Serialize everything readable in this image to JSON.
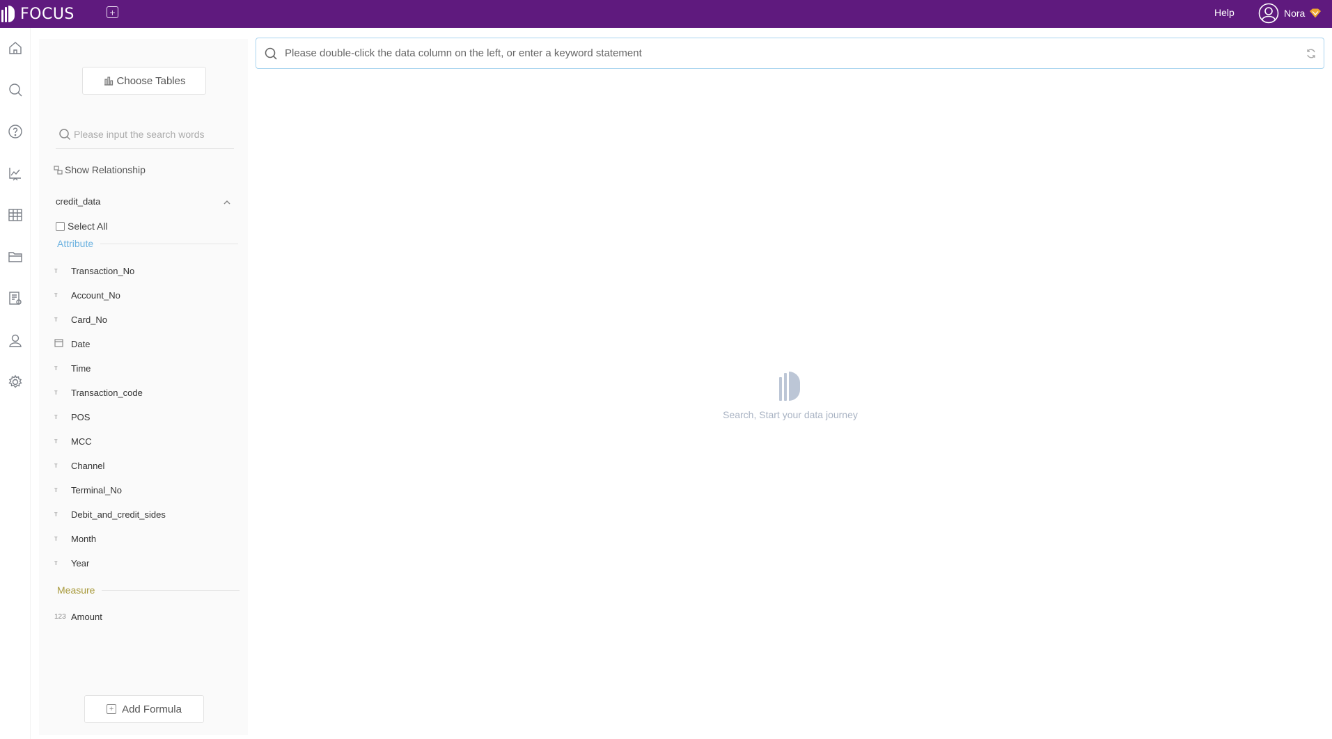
{
  "app": {
    "brand": "FOCUS",
    "help_label": "Help",
    "user_name": "Nora"
  },
  "colors": {
    "topbar": "#5f1a7e",
    "attribute_accent": "#6cb2e0",
    "measure_accent": "#a89a3c"
  },
  "nav": {
    "items": [
      {
        "icon": "home-icon"
      },
      {
        "icon": "search-icon"
      },
      {
        "icon": "help-circle-icon"
      },
      {
        "icon": "presentation-chart-icon"
      },
      {
        "icon": "table-grid-icon"
      },
      {
        "icon": "folder-icon"
      },
      {
        "icon": "report-settings-icon"
      },
      {
        "icon": "user-icon"
      },
      {
        "icon": "gear-icon"
      }
    ]
  },
  "panel": {
    "choose_tables_label": "Choose Tables",
    "search_placeholder": "Please input the search words",
    "show_relationship_label": "Show Relationship",
    "table_name": "credit_data",
    "select_all_label": "Select All",
    "attribute_label": "Attribute",
    "measure_label": "Measure",
    "attributes": [
      {
        "label": "Transaction_No",
        "type": "text"
      },
      {
        "label": "Account_No",
        "type": "text"
      },
      {
        "label": "Card_No",
        "type": "text"
      },
      {
        "label": "Date",
        "type": "date"
      },
      {
        "label": "Time",
        "type": "text"
      },
      {
        "label": "Transaction_code",
        "type": "text"
      },
      {
        "label": "POS",
        "type": "text"
      },
      {
        "label": "MCC",
        "type": "text"
      },
      {
        "label": "Channel",
        "type": "text"
      },
      {
        "label": "Terminal_No",
        "type": "text"
      },
      {
        "label": "Debit_and_credit_sides",
        "type": "text"
      },
      {
        "label": "Month",
        "type": "text"
      },
      {
        "label": "Year",
        "type": "text"
      }
    ],
    "measures": [
      {
        "label": "Amount",
        "type_label": "123"
      }
    ],
    "add_formula_label": "Add Formula"
  },
  "main": {
    "search_placeholder": "Please double-click the data column on the left, or enter a keyword statement",
    "empty_text": "Search, Start your data journey"
  }
}
